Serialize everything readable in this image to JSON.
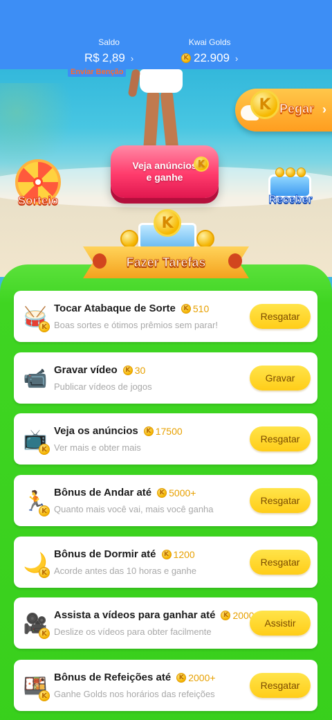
{
  "header": {
    "saldo_label": "Saldo",
    "saldo_currency": "R$",
    "saldo_value": "2,89",
    "golds_label": "Kwai Golds",
    "golds_value": "22.909",
    "enviar_label": "Enviar Benção",
    "chevron": "›",
    "coin_glyph": "K"
  },
  "scene": {
    "ad_button_label": "Veja anúncios e ganhe",
    "pegar_label": "Pegar",
    "sorteio_label": "Sorteio",
    "receber_label": "Receber",
    "ribbon_label": "Fazer Tarefas"
  },
  "colors": {
    "header_blue": "#3d8ef5",
    "panel_green": "#3fd522",
    "button_yellow": "#ffd325",
    "reward_gold": "#e7a000",
    "ad_button_pink": "#ff3b6c"
  },
  "tasks": [
    {
      "icon": "drum-icon",
      "title": "Tocar Atabaque de Sorte",
      "reward": "510",
      "subtitle": "Boas sortes e ótimos prêmios sem parar!",
      "button": "Resgatar"
    },
    {
      "icon": "video-record-icon",
      "title": "Gravar vídeo",
      "reward": "30",
      "subtitle": "Publicar vídeos de jogos",
      "button": "Gravar"
    },
    {
      "icon": "tv-icon",
      "title": "Veja os anúncios",
      "reward": "17500",
      "subtitle": "Ver mais e obter mais",
      "button": "Resgatar"
    },
    {
      "icon": "walking-icon",
      "title": "Bônus de Andar até",
      "reward": "5000+",
      "subtitle": "Quanto mais você vai, mais você ganha",
      "button": "Resgatar"
    },
    {
      "icon": "moon-icon",
      "title": "Bônus de Dormir até",
      "reward": "1200",
      "subtitle": "Acorde antes das 10 horas e ganhe",
      "button": "Resgatar"
    },
    {
      "icon": "camera-icon",
      "title": "Assista a vídeos para ganhar até",
      "reward": "2000",
      "subtitle": "Deslize os vídeos para obter facilmente",
      "button": "Assistir"
    },
    {
      "icon": "meal-icon",
      "title": "Bônus de Refeições até",
      "reward": "2000+",
      "subtitle": "Ganhe Golds nos horários das refeições",
      "button": "Resgatar"
    }
  ]
}
